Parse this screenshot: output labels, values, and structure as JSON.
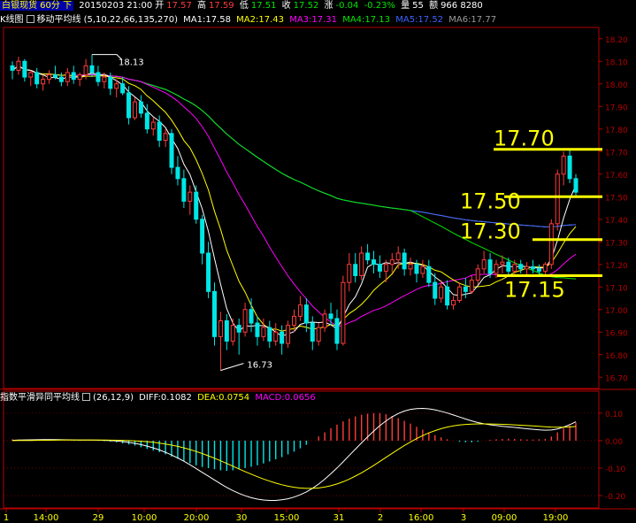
{
  "header": {
    "title": "白银现货 60分 下",
    "date": "20150203 21:00",
    "open_label": "开",
    "open": "17.57",
    "high_label": "高",
    "high": "17.59",
    "low_label": "低",
    "low": "17.51",
    "close_label": "收",
    "close": "17.52",
    "change_label": "涨",
    "change": "-0.04",
    "change_pct": "-0.23%",
    "volume_label": "量",
    "volume": "55",
    "amount_label": "额",
    "amount": "966 8280"
  },
  "ma_bar": {
    "name": "K线图",
    "indicator": "移动平均线",
    "params": "(5,10,22,66,135,270)",
    "ma1": "MA1:17.58",
    "ma2": "MA2:17.43",
    "ma3": "MA3:17.31",
    "ma4": "MA4:17.13",
    "ma5": "MA5:17.52",
    "ma6": "MA6:17.77"
  },
  "macd_bar": {
    "name": "指数平滑异同平均线",
    "params": "(26,12,9)",
    "diff": "DIFF:0.1082",
    "dea": "DEA:0.0754",
    "macd": "MACD:0.0656"
  },
  "price_axis": {
    "ticks": [
      "18.20",
      "18.10",
      "18.00",
      "17.90",
      "17.80",
      "17.70",
      "17.60",
      "17.50",
      "17.40",
      "17.30",
      "17.20",
      "17.10",
      "17.00",
      "16.90",
      "16.80",
      "16.70"
    ]
  },
  "macd_axis": {
    "ticks": [
      "0.10",
      "0.00",
      "-0.10",
      "-0.20"
    ]
  },
  "time_axis": {
    "labels": [
      "1",
      "14:00",
      "29",
      "10:00",
      "20:00",
      "30",
      "15:00",
      "31",
      "2",
      "16:00",
      "3",
      "09:00",
      "19:00"
    ]
  },
  "annotations": {
    "high_mark": "18.13",
    "low_mark": "16.73",
    "levels": [
      {
        "label": "17.70",
        "price": 17.71
      },
      {
        "label": "17.50",
        "price": 17.5
      },
      {
        "label": "17.30",
        "price": 17.31
      },
      {
        "label": "17.15",
        "price": 17.15
      }
    ]
  },
  "colors": {
    "background": "#000000",
    "frame": "#b40000",
    "up": "#ff3c3c",
    "down": "#00e6e6",
    "level_line": "#ffff00",
    "ma1": "#ffffff",
    "ma2": "#ffff00",
    "ma3": "#ff00ff",
    "ma4": "#00e600",
    "ma5": "#3c64ff",
    "ma6": "#9a9a9a"
  },
  "chart_data": {
    "type": "candlestick",
    "price_range": [
      16.65,
      18.25
    ],
    "macd_range": [
      -0.245,
      0.135
    ],
    "candles_ohlc": [
      [
        18.08,
        18.1,
        18.02,
        18.06
      ],
      [
        18.06,
        18.12,
        18.04,
        18.1
      ],
      [
        18.1,
        18.11,
        18.01,
        18.03
      ],
      [
        18.03,
        18.06,
        17.99,
        18.05
      ],
      [
        18.05,
        18.07,
        17.98,
        18.0
      ],
      [
        18.0,
        18.04,
        17.97,
        18.02
      ],
      [
        18.02,
        18.06,
        18.0,
        18.04
      ],
      [
        18.04,
        18.08,
        18.02,
        18.03
      ],
      [
        18.03,
        18.05,
        17.99,
        18.01
      ],
      [
        18.01,
        18.07,
        17.99,
        18.05
      ],
      [
        18.05,
        18.08,
        18.0,
        18.02
      ],
      [
        18.02,
        18.05,
        17.99,
        18.04
      ],
      [
        18.04,
        18.11,
        18.02,
        18.08
      ],
      [
        18.08,
        18.13,
        18.03,
        18.05
      ],
      [
        18.05,
        18.08,
        17.99,
        18.01
      ],
      [
        18.01,
        18.05,
        17.98,
        18.03
      ],
      [
        18.03,
        18.05,
        17.95,
        17.98
      ],
      [
        17.98,
        18.02,
        17.94,
        18.0
      ],
      [
        18.0,
        18.03,
        17.95,
        17.96
      ],
      [
        17.96,
        17.99,
        17.82,
        17.85
      ],
      [
        17.85,
        17.94,
        17.84,
        17.92
      ],
      [
        17.92,
        17.95,
        17.85,
        17.87
      ],
      [
        17.87,
        17.91,
        17.78,
        17.8
      ],
      [
        17.8,
        17.85,
        17.77,
        17.83
      ],
      [
        17.83,
        17.86,
        17.72,
        17.75
      ],
      [
        17.75,
        17.8,
        17.72,
        17.78
      ],
      [
        17.78,
        17.8,
        17.6,
        17.63
      ],
      [
        17.63,
        17.68,
        17.55,
        17.58
      ],
      [
        17.58,
        17.62,
        17.45,
        17.48
      ],
      [
        17.48,
        17.55,
        17.42,
        17.52
      ],
      [
        17.52,
        17.55,
        17.38,
        17.4
      ],
      [
        17.4,
        17.42,
        17.2,
        17.25
      ],
      [
        17.25,
        17.3,
        17.05,
        17.08
      ],
      [
        17.08,
        17.12,
        16.84,
        16.88
      ],
      [
        16.88,
        16.99,
        16.73,
        16.95
      ],
      [
        16.95,
        16.98,
        16.82,
        16.86
      ],
      [
        16.86,
        16.96,
        16.84,
        16.93
      ],
      [
        16.93,
        16.96,
        16.8,
        16.9
      ],
      [
        16.9,
        17.03,
        16.88,
        17.0
      ],
      [
        17.0,
        17.05,
        16.9,
        16.94
      ],
      [
        16.94,
        16.97,
        16.84,
        16.88
      ],
      [
        16.88,
        16.96,
        16.86,
        16.92
      ],
      [
        16.92,
        16.95,
        16.83,
        16.86
      ],
      [
        16.86,
        16.94,
        16.84,
        16.9
      ],
      [
        16.9,
        16.93,
        16.8,
        16.85
      ],
      [
        16.85,
        16.95,
        16.83,
        16.93
      ],
      [
        16.93,
        17.0,
        16.9,
        16.97
      ],
      [
        16.97,
        17.06,
        16.95,
        17.02
      ],
      [
        17.02,
        17.05,
        16.9,
        16.94
      ],
      [
        16.94,
        16.97,
        16.82,
        16.86
      ],
      [
        16.86,
        16.94,
        16.84,
        16.92
      ],
      [
        16.92,
        17.0,
        16.9,
        16.98
      ],
      [
        16.98,
        17.03,
        16.93,
        16.96
      ],
      [
        16.96,
        17.0,
        16.82,
        16.85
      ],
      [
        16.85,
        17.15,
        16.84,
        17.12
      ],
      [
        17.12,
        17.25,
        17.08,
        17.2
      ],
      [
        17.2,
        17.25,
        17.12,
        17.15
      ],
      [
        17.15,
        17.28,
        17.13,
        17.25
      ],
      [
        17.25,
        17.29,
        17.2,
        17.22
      ],
      [
        17.22,
        17.26,
        17.16,
        17.2
      ],
      [
        17.2,
        17.24,
        17.14,
        17.17
      ],
      [
        17.17,
        17.22,
        17.12,
        17.2
      ],
      [
        17.2,
        17.25,
        17.16,
        17.22
      ],
      [
        17.22,
        17.28,
        17.18,
        17.25
      ],
      [
        17.25,
        17.27,
        17.15,
        17.18
      ],
      [
        17.18,
        17.23,
        17.15,
        17.2
      ],
      [
        17.2,
        17.22,
        17.12,
        17.16
      ],
      [
        17.16,
        17.22,
        17.14,
        17.19
      ],
      [
        17.19,
        17.22,
        17.1,
        17.12
      ],
      [
        17.12,
        17.16,
        17.02,
        17.05
      ],
      [
        17.05,
        17.13,
        17.03,
        17.1
      ],
      [
        17.1,
        17.13,
        17.0,
        17.02
      ],
      [
        17.02,
        17.06,
        17.0,
        17.04
      ],
      [
        17.04,
        17.12,
        17.03,
        17.1
      ],
      [
        17.1,
        17.14,
        17.05,
        17.08
      ],
      [
        17.08,
        17.15,
        17.07,
        17.13
      ],
      [
        17.13,
        17.2,
        17.11,
        17.18
      ],
      [
        17.18,
        17.26,
        17.16,
        17.22
      ],
      [
        17.22,
        17.25,
        17.14,
        17.16
      ],
      [
        17.16,
        17.22,
        17.14,
        17.2
      ],
      [
        17.2,
        17.24,
        17.16,
        17.21
      ],
      [
        17.21,
        17.23,
        17.15,
        17.17
      ],
      [
        17.17,
        17.22,
        17.15,
        17.2
      ],
      [
        17.2,
        17.22,
        17.16,
        17.18
      ],
      [
        17.18,
        17.21,
        17.15,
        17.19
      ],
      [
        17.19,
        17.22,
        17.16,
        17.18
      ],
      [
        17.18,
        17.2,
        17.15,
        17.17
      ],
      [
        17.17,
        17.21,
        17.15,
        17.2
      ],
      [
        17.2,
        17.4,
        17.18,
        17.38
      ],
      [
        17.38,
        17.62,
        17.35,
        17.6
      ],
      [
        17.6,
        17.7,
        17.55,
        17.68
      ],
      [
        17.68,
        17.71,
        17.56,
        17.58
      ],
      [
        17.58,
        17.6,
        17.5,
        17.52
      ]
    ],
    "macd_bars": [
      0.005,
      0.004,
      0.004,
      0.003,
      0.002,
      0.002,
      0.001,
      0.001,
      0.0,
      0.0,
      -0.001,
      -0.001,
      0.0,
      0.0,
      -0.001,
      -0.002,
      -0.004,
      -0.006,
      -0.01,
      -0.014,
      -0.018,
      -0.024,
      -0.03,
      -0.036,
      -0.042,
      -0.05,
      -0.058,
      -0.066,
      -0.074,
      -0.082,
      -0.09,
      -0.096,
      -0.1,
      -0.104,
      -0.108,
      -0.11,
      -0.108,
      -0.104,
      -0.1,
      -0.095,
      -0.09,
      -0.083,
      -0.076,
      -0.068,
      -0.06,
      -0.05,
      -0.04,
      -0.028,
      -0.015,
      0.0,
      0.015,
      0.03,
      0.045,
      0.058,
      0.07,
      0.08,
      0.088,
      0.094,
      0.098,
      0.1,
      0.1,
      0.096,
      0.09,
      0.082,
      0.072,
      0.062,
      0.05,
      0.04,
      0.03,
      0.02,
      0.012,
      0.005,
      0.0,
      -0.004,
      -0.006,
      -0.006,
      -0.004,
      0.0,
      0.003,
      0.005,
      0.006,
      0.007,
      0.006,
      0.005,
      0.004,
      0.004,
      0.005,
      0.006,
      0.015,
      0.03,
      0.045,
      0.055,
      0.066
    ]
  }
}
